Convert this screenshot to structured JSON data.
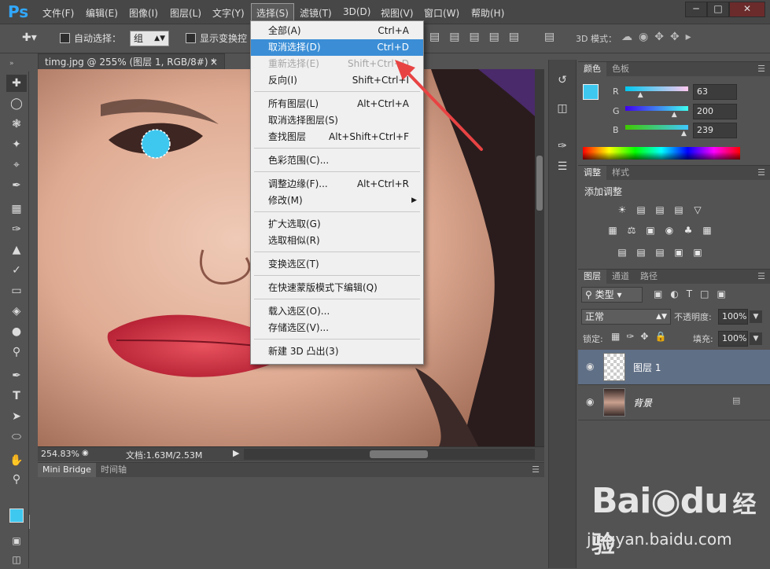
{
  "menubar": {
    "logo": "Ps",
    "items": [
      "文件(F)",
      "编辑(E)",
      "图像(I)",
      "图层(L)",
      "文字(Y)",
      "选择(S)",
      "滤镜(T)",
      "3D(D)",
      "视图(V)",
      "窗口(W)",
      "帮助(H)"
    ],
    "active_item": "选择(S)"
  },
  "options_bar": {
    "auto_select_label": "自动选择：",
    "auto_select_value": "组",
    "show_transform_label": "显示变换控",
    "mode3d_label": "3D 模式："
  },
  "document": {
    "tab_title": "timg.jpg @ 255% (图层 1, RGB/8#) *",
    "zoom": "254.83%",
    "doc_size": "文档:1.63M/2.53M"
  },
  "select_menu": {
    "items": [
      {
        "label": "全部(A)",
        "shortcut": "Ctrl+A"
      },
      {
        "label": "取消选择(D)",
        "shortcut": "Ctrl+D",
        "highlighted": true
      },
      {
        "label": "重新选择(E)",
        "shortcut": "Shift+Ctrl+D",
        "disabled": true
      },
      {
        "label": "反向(I)",
        "shortcut": "Shift+Ctrl+I"
      },
      {
        "label": "所有图层(L)",
        "shortcut": "Alt+Ctrl+A"
      },
      {
        "label": "取消选择图层(S)",
        "shortcut": ""
      },
      {
        "label": "查找图层",
        "shortcut": "Alt+Shift+Ctrl+F"
      },
      {
        "label": "色彩范围(C)...",
        "shortcut": ""
      },
      {
        "label": "调整边缘(F)...",
        "shortcut": "Alt+Ctrl+R"
      },
      {
        "label": "修改(M)",
        "shortcut": ""
      },
      {
        "label": "扩大选取(G)",
        "shortcut": ""
      },
      {
        "label": "选取相似(R)",
        "shortcut": ""
      },
      {
        "label": "变换选区(T)",
        "shortcut": ""
      },
      {
        "label": "在快速蒙版模式下编辑(Q)",
        "shortcut": ""
      },
      {
        "label": "载入选区(O)...",
        "shortcut": ""
      },
      {
        "label": "存储选区(V)...",
        "shortcut": ""
      },
      {
        "label": "新建 3D 凸出(3)",
        "shortcut": ""
      }
    ]
  },
  "color_panel": {
    "tabs": [
      "颜色",
      "色板"
    ],
    "r_label": "R",
    "g_label": "G",
    "b_label": "B",
    "r": "63",
    "g": "200",
    "b": "239",
    "r_level": 0.247,
    "g_level": 0.784,
    "b_level": 0.937,
    "foreground": "#3fc8ef"
  },
  "adjust_panel": {
    "tabs": [
      "调整",
      "样式"
    ],
    "title": "添加调整"
  },
  "layers_panel": {
    "tabs": [
      "图层",
      "通道",
      "路径"
    ],
    "filter_kind": "类型",
    "blend_mode": "正常",
    "opacity_label": "不透明度:",
    "opacity": "100%",
    "lock_label": "锁定:",
    "fill_label": "填充:",
    "fill": "100%",
    "layers": [
      {
        "name": "图层 1",
        "selected": true
      },
      {
        "name": "背景",
        "selected": false,
        "locked": true
      }
    ]
  },
  "bottom_panel": {
    "tabs": [
      "Mini Bridge",
      "时间轴"
    ]
  },
  "watermark": {
    "brand": "Bai",
    "brand2": "du",
    "cn": "经验",
    "url": "jingyan.baidu.com"
  },
  "colors": {
    "accent": "#3b8ed6",
    "ps_blue": "#31a8ff",
    "cyan_dot": "#3fc8ef",
    "arrow": "#e84343"
  }
}
